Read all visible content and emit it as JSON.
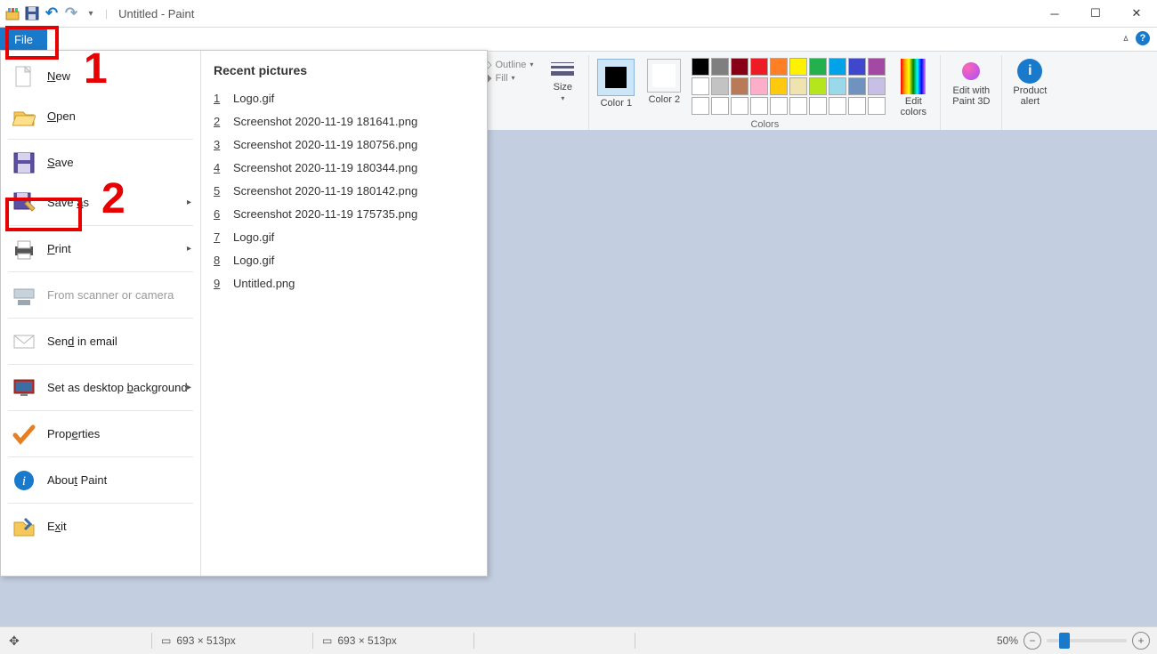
{
  "title": "Untitled - Paint",
  "file_tab": "File",
  "annotations": {
    "n1": "1",
    "n2": "2"
  },
  "ribbon": {
    "outline": "Outline",
    "fill": "Fill",
    "size": "Size",
    "color1": "Color 1",
    "color2": "Color 2",
    "colors_group": "Colors",
    "edit_colors": "Edit colors",
    "paint3d": "Edit with Paint 3D",
    "product_alert": "Product alert",
    "palette_row1": [
      "#000000",
      "#7f7f7f",
      "#880015",
      "#ed1c24",
      "#ff7f27",
      "#fff200",
      "#22b14c",
      "#00a2e8",
      "#3f48cc",
      "#a349a4"
    ],
    "palette_row2": [
      "#ffffff",
      "#c3c3c3",
      "#b97a57",
      "#ffaec9",
      "#ffc90e",
      "#efe4b0",
      "#b5e61d",
      "#99d9ea",
      "#7092be",
      "#c8bfe7"
    ],
    "palette_row3": [
      "",
      "",
      "",
      "",
      "",
      "",
      "",
      "",
      "",
      ""
    ]
  },
  "menu": {
    "new": "New",
    "open": "Open",
    "save": "Save",
    "saveas": "Save as",
    "print": "Print",
    "scanner": "From scanner or camera",
    "sendemail": "Send in email",
    "desktop": "Set as desktop background",
    "properties": "Properties",
    "about": "About Paint",
    "exit": "Exit"
  },
  "recent": {
    "title": "Recent pictures",
    "items": [
      "Logo.gif",
      "Screenshot 2020-11-19 181641.png",
      "Screenshot 2020-11-19 180756.png",
      "Screenshot 2020-11-19 180344.png",
      "Screenshot 2020-11-19 180142.png",
      "Screenshot 2020-11-19 175735.png",
      "Logo.gif",
      "Logo.gif",
      "Untitled.png"
    ]
  },
  "status": {
    "dim1": "693 × 513px",
    "dim2": "693 × 513px",
    "zoom": "50%"
  }
}
